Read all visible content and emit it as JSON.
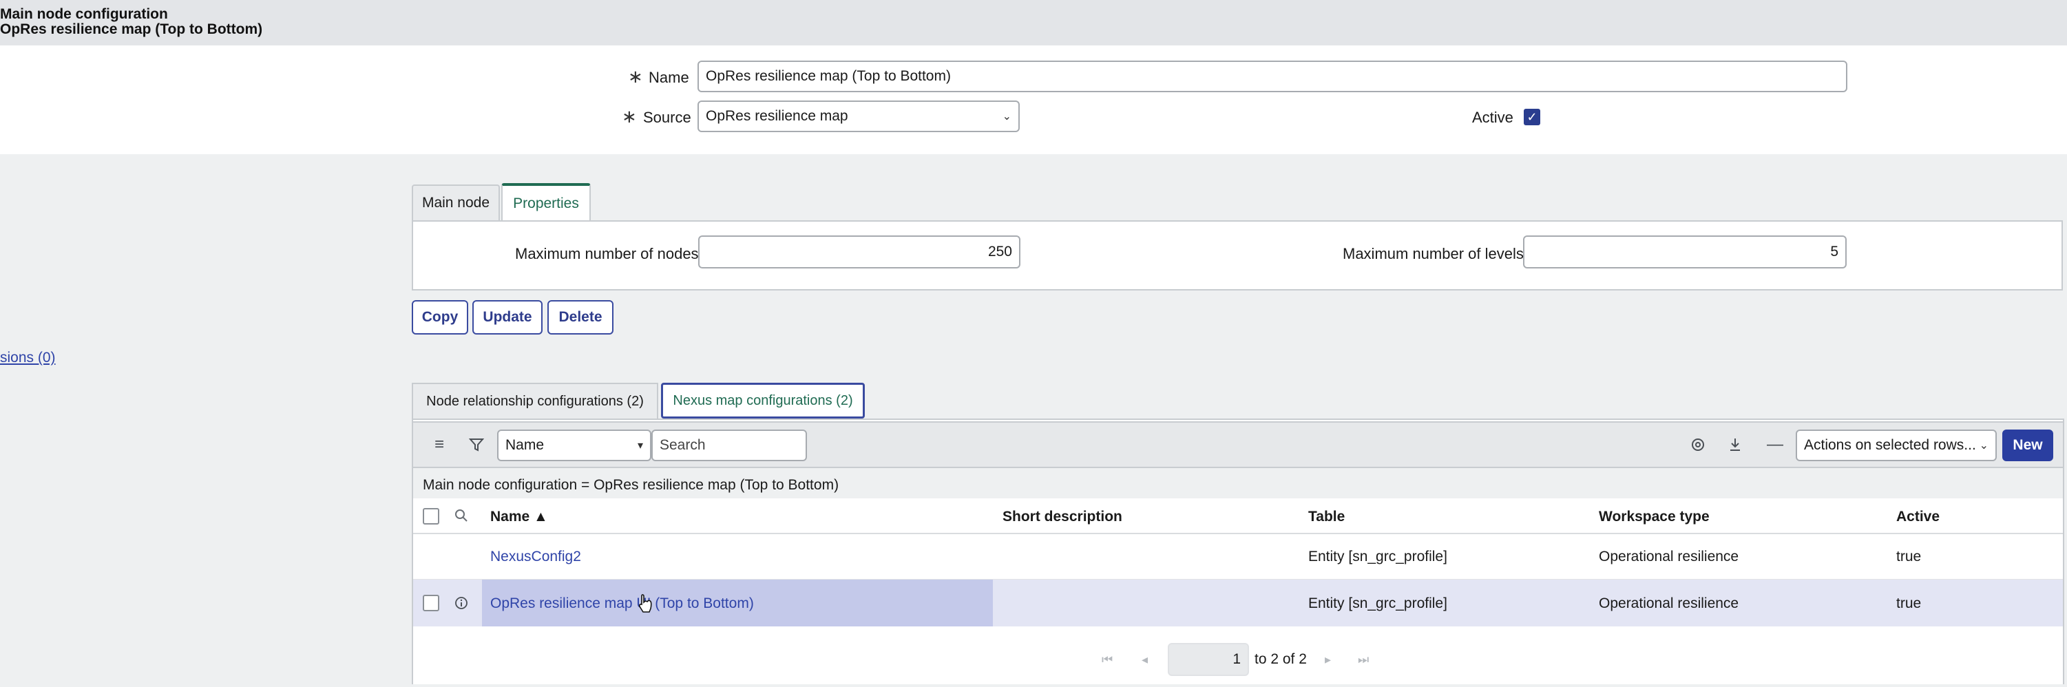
{
  "header": {
    "line1": "Main node configuration",
    "line2": "OpRes resilience map (Top to Bottom)"
  },
  "form": {
    "required_mark": "∗",
    "name_label": "Name",
    "name_value": "OpRes resilience map (Top to Bottom)",
    "source_label": "Source",
    "source_value": "OpRes resilience map",
    "active_label": "Active",
    "active_checked": true
  },
  "tabs": {
    "main_node": "Main node",
    "properties": "Properties"
  },
  "properties": {
    "max_nodes_label": "Maximum number of nodes",
    "max_nodes_value": "250",
    "max_levels_label": "Maximum number of levels",
    "max_levels_value": "5"
  },
  "buttons": {
    "copy": "Copy",
    "update": "Update",
    "delete": "Delete"
  },
  "left_link": "sions (0)",
  "related_tabs": {
    "node_rel": "Node relationship configurations (2)",
    "nexus_map": "Nexus map configurations (2)"
  },
  "list_toolbar": {
    "field_select": "Name",
    "search_placeholder": "Search",
    "actions_select": "Actions on selected rows...",
    "new_button": "New"
  },
  "breadcrumb": "Main node configuration = OpRes resilience map (Top to Bottom)",
  "table": {
    "columns": {
      "name": "Name ▲",
      "short_description": "Short description",
      "table": "Table",
      "workspace_type": "Workspace type",
      "active": "Active"
    },
    "rows": [
      {
        "name": "NexusConfig2",
        "short_description": "",
        "table": "Entity [sn_grc_profile]",
        "workspace_type": "Operational resilience",
        "active": "true"
      },
      {
        "name": "OpRes resilience map UI (Top to Bottom)",
        "short_description": "",
        "table": "Entity [sn_grc_profile]",
        "workspace_type": "Operational resilience",
        "active": "true"
      }
    ]
  },
  "pager": {
    "current": "1",
    "range_text": "to 2 of 2"
  },
  "colors": {
    "accent_green": "#1f6b52",
    "primary_blue": "#2a3ea0",
    "link_blue": "#2f44a8"
  }
}
